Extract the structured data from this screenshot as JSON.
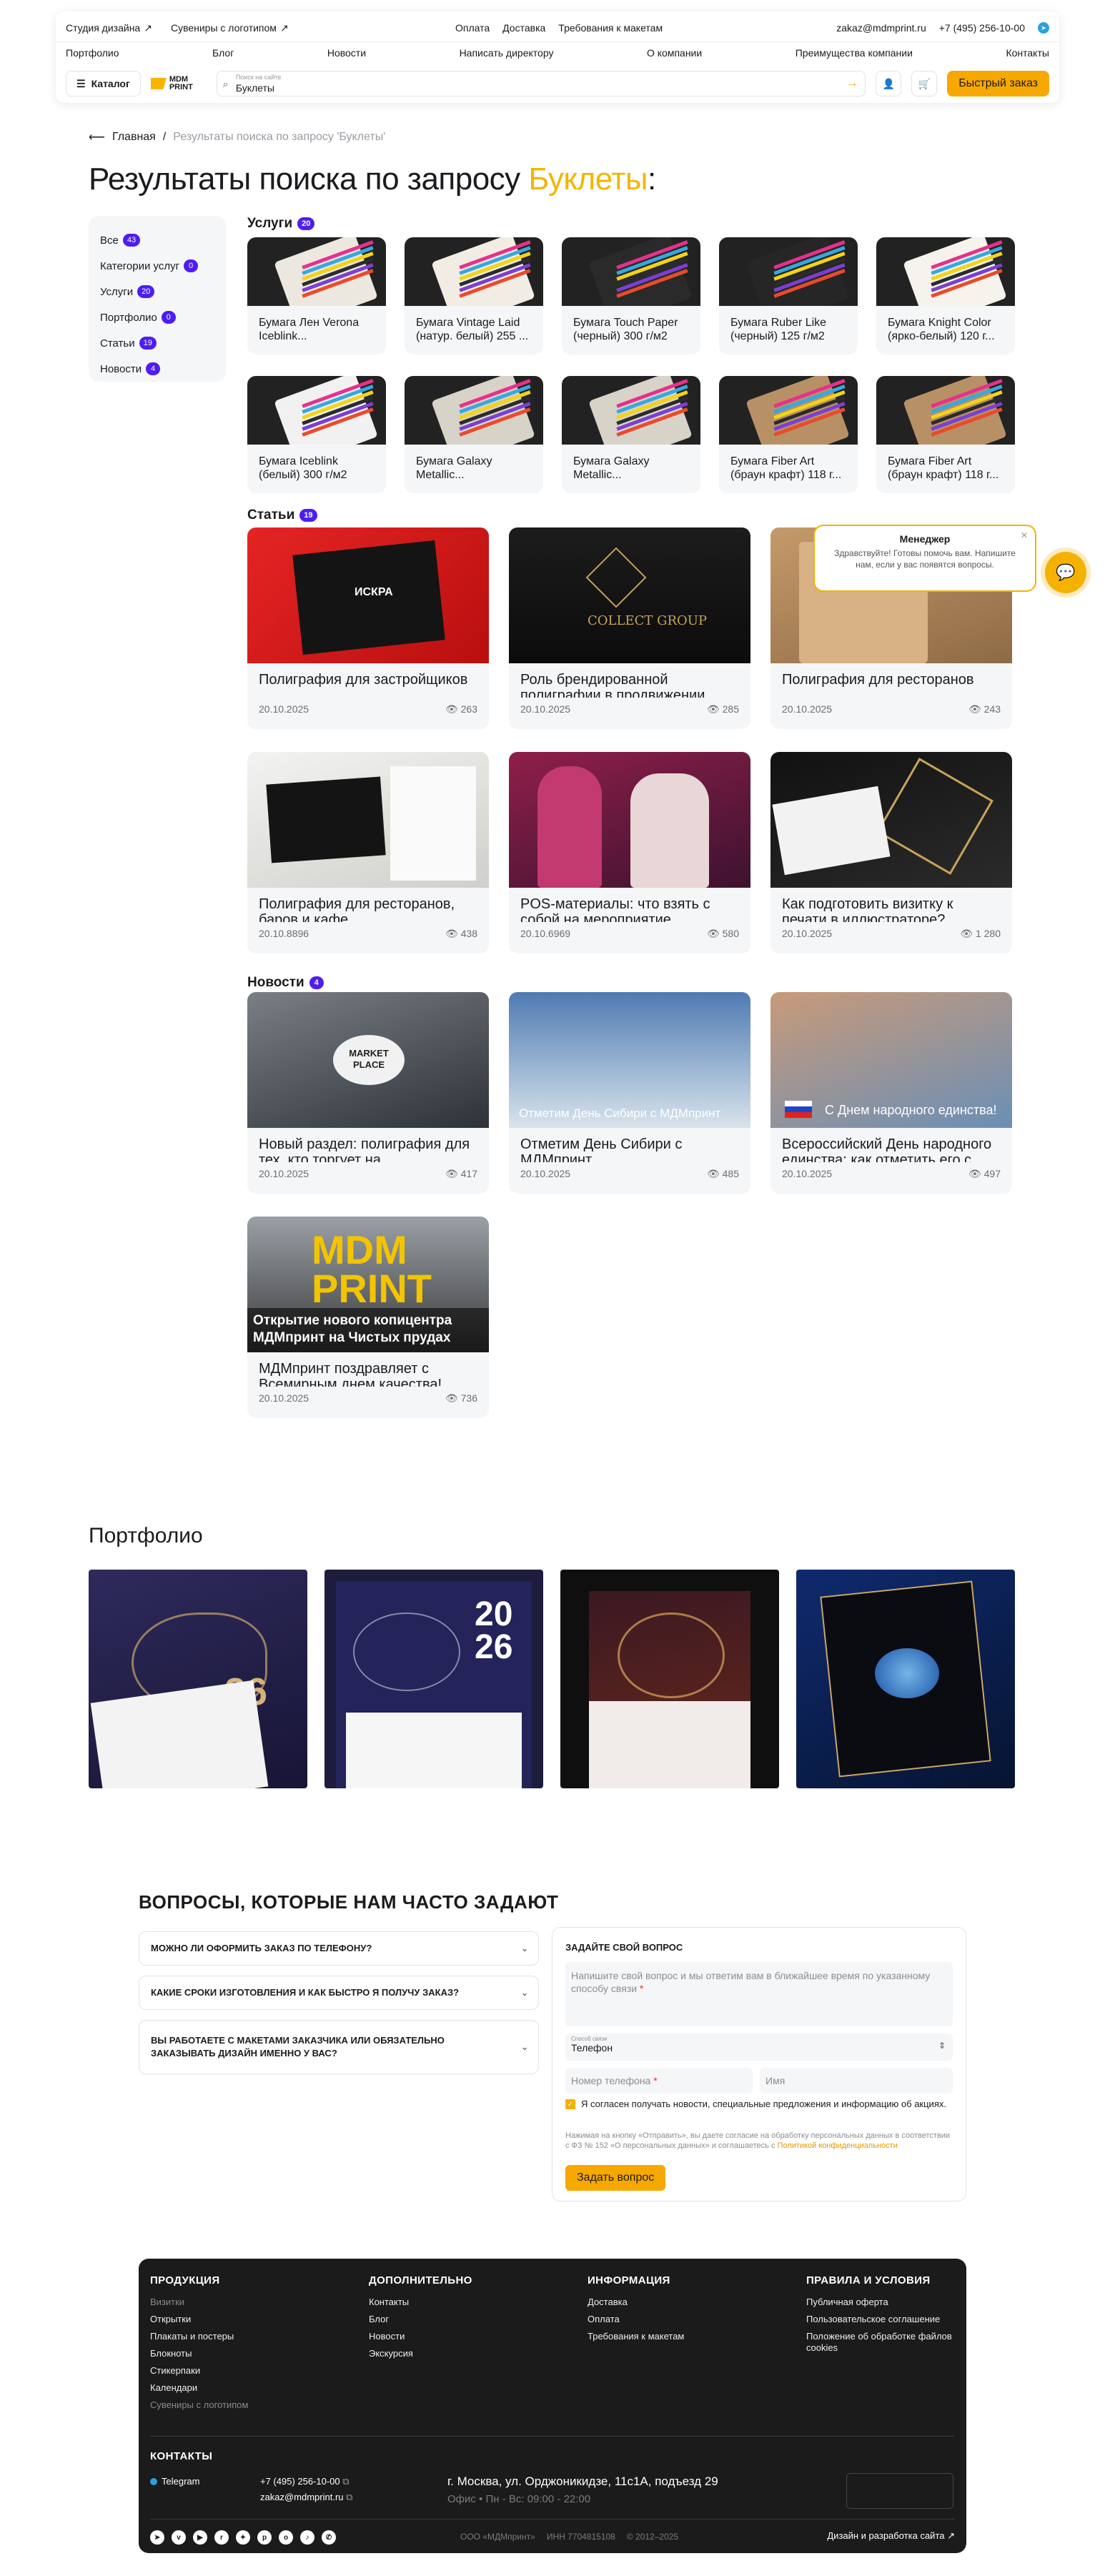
{
  "header": {
    "top_links": [
      "Студия дизайна",
      "Сувениры с логотипом"
    ],
    "mid_links": [
      "Оплата",
      "Доставка",
      "Требования к макетам"
    ],
    "email": "zakaz@mdmprint.ru",
    "phone": "+7 (495) 256-10-00",
    "nav": [
      "Портфолио",
      "Блог",
      "Новости",
      "Написать директору",
      "О компании",
      "Преимущества компании",
      "Контакты"
    ],
    "catalog": "Каталог",
    "logo_l1": "MDM",
    "logo_l2": "PRINT",
    "search_placeholder": "Поиск на сайте",
    "search_value": "Буклеты",
    "quick_order": "Быстрый заказ"
  },
  "breadcrumb": {
    "home": "Главная",
    "sep": "/",
    "current": "Результаты поиска по запросу 'Буклеты'"
  },
  "page_title": {
    "prefix": "Результаты поиска по запросу ",
    "query": "Буклеты",
    "suffix": ":"
  },
  "filter": [
    {
      "label": "Все",
      "count": "43"
    },
    {
      "label": "Категории услуг",
      "count": "0"
    },
    {
      "label": "Услуги",
      "count": "20"
    },
    {
      "label": "Портфолио",
      "count": "0"
    },
    {
      "label": "Статьи",
      "count": "19"
    },
    {
      "label": "Новости",
      "count": "4"
    }
  ],
  "services": {
    "title": "Услуги",
    "count": "20",
    "items": [
      "Бумага Лен Verona Iceblink...",
      "Бумага Vintage Laid (натур. белый) 255 ...",
      "Бумага Touch Paper (черный) 300 г/м2",
      "Бумага Ruber Like (черный) 125 г/м2",
      "Бумага Knight Color (ярко-белый) 120 г...",
      "Бумага Iceblink (белый) 300 г/м2",
      "Бумага Galaxy Metallic...",
      "Бумага Galaxy Metallic...",
      "Бумага Fiber Art (браун крафт) 118 г...",
      "Бумага Fiber Art (браун крафт) 118 г..."
    ]
  },
  "articles": {
    "title": "Статьи",
    "count": "19",
    "items": [
      {
        "title": "Полиграфия для застройщиков",
        "date": "20.10.2025",
        "views": "263"
      },
      {
        "title": "Роль брендированной полиграфии в продвижении...",
        "date": "20.10.2025",
        "views": "285"
      },
      {
        "title": "Полиграфия для ресторанов",
        "date": "20.10.2025",
        "views": "243"
      },
      {
        "title": "Полиграфия для ресторанов, баров и кафе",
        "date": "20.10.8896",
        "views": "438"
      },
      {
        "title": "POS-материалы: что взять с собой на мероприятие",
        "date": "20.10.6969",
        "views": "580"
      },
      {
        "title": "Как подготовить визитку к печати в иллюстраторе?",
        "date": "20.10.2025",
        "views": "1 280"
      }
    ],
    "img_texts": [
      "ИСКРА",
      "COLLECT GROUP",
      "",
      "",
      "",
      ""
    ]
  },
  "news": {
    "title": "Новости",
    "count": "4",
    "items": [
      {
        "title": "Новый раздел: полиграфия для тех, кто торгует на...",
        "date": "20.10.2025",
        "views": "417",
        "overlay": "MARKET PLACE"
      },
      {
        "title": "Отметим День Сибири с МДМпринт",
        "date": "20.10.2025",
        "views": "485",
        "overlay": "Отметим День Сибири с МДМпринт"
      },
      {
        "title": "Всероссийский День народного единства: как отметить его с...",
        "date": "20.10.2025",
        "views": "497",
        "overlay": "С Днем народного единства!"
      },
      {
        "title": "МДМпринт поздравляет с Всемирным днем качества!",
        "date": "20.10.2025",
        "views": "736",
        "overlay": "Открытие нового копицентра МДМпринт на Чистых прудах"
      }
    ]
  },
  "chat": {
    "name": "Менеджер",
    "message": "Здравствуйте! Готовы помочь вам. Напишите нам, если у вас появятся вопросы."
  },
  "portfolio": {
    "title": "Портфолио"
  },
  "faq": {
    "title": "ВОПРОСЫ, КОТОРЫЕ НАМ ЧАСТО ЗАДАЮТ",
    "items": [
      "МОЖНО ЛИ ОФОРМИТЬ ЗАКАЗ ПО ТЕЛЕФОНУ?",
      "КАКИЕ СРОКИ ИЗГОТОВЛЕНИЯ И КАК БЫСТРО Я ПОЛУЧУ ЗАКАЗ?",
      "ВЫ РАБОТАЕТЕ С МАКЕТАМИ ЗАКАЗЧИКА ИЛИ ОБЯЗАТЕЛЬНО ЗАКАЗЫВАТЬ ДИЗАЙН ИМЕННО У ВАС?"
    ]
  },
  "form": {
    "title": "ЗАДАЙТЕ СВОЙ ВОПРОС",
    "question_placeholder": "Напишите свой вопрос и мы ответим вам в ближайшее время по указанному способу связи",
    "contact_label": "Способ связи",
    "contact_value": "Телефон",
    "phone_placeholder": "Номер телефона",
    "name_placeholder": "Имя",
    "consent": "Я согласен получать новости, специальные предложения и информацию об акциях.",
    "legal": "Нажимая на кнопку «Отправить», вы даете согласие на обработку персональных данных в соответствии с ФЗ № 152 «О персональных данных» и соглашаетесь с",
    "legal_link": "Политикой конфиденциальности",
    "submit": "Задать вопрос"
  },
  "footer": {
    "cols": [
      {
        "title": "ПРОДУКЦИЯ",
        "links": [
          "Визитки",
          "Открытки",
          "Плакаты и постеры",
          "Блокноты",
          "Стикерпаки",
          "Календари",
          "Сувениры с логотипом"
        ]
      },
      {
        "title": "ДОПОЛНИТЕЛЬНО",
        "links": [
          "Контакты",
          "Блог",
          "Новости",
          "Экскурсия"
        ]
      },
      {
        "title": "ИНФОРМАЦИЯ",
        "links": [
          "Доставка",
          "Оплата",
          "Требования к макетам"
        ]
      },
      {
        "title": "ПРАВИЛА И УСЛОВИЯ",
        "links": [
          "Публичная оферта",
          "Пользовательское соглашение",
          "Положение об обработке файлов cookies"
        ]
      }
    ],
    "contacts_title": "КОНТАКТЫ",
    "telegram": "Telegram",
    "phone": "+7 (495) 256-10-00",
    "email": "zakaz@mdmprint.ru",
    "address": "г. Москва, ул. Орджоникидзе, 11с1А, подъезд 29",
    "hours": "Офис • Пн - Вс: 09:00 - 22:00",
    "company": "ООО «МДМпринт»",
    "inn": "ИНН 7704815108",
    "years": "© 2012–2025",
    "dev": "Дизайн и разработка сайта"
  },
  "colors": {
    "accent": "#f7a800",
    "badge": "#4d1df2",
    "footer_bg": "#1b1b1b"
  }
}
